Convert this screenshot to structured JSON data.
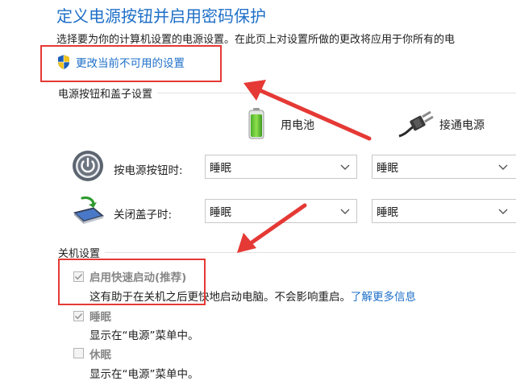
{
  "header": {
    "title": "定义电源按钮并启用密码保护",
    "description": "选择要为你的计算机设置的电源设置。在此页上对设置所做的更改将应用于你所有的电",
    "change_link": "更改当前不可用的设置"
  },
  "power_section": {
    "heading": "电源按钮和盖子设置",
    "battery_label": "用电池",
    "plugged_label": "接通电源",
    "rows": [
      {
        "label": "按电源按钮时:",
        "battery_value": "睡眠",
        "plugged_value": "睡眠"
      },
      {
        "label": "关闭盖子时:",
        "battery_value": "睡眠",
        "plugged_value": "睡眠"
      }
    ]
  },
  "shutdown_section": {
    "heading": "关机设置",
    "options": [
      {
        "title": "启用快速启动(推荐)",
        "sub": "这有助于在关机之后更快地启动电脑。不会影响重启。",
        "link": "了解更多信息",
        "checked": true
      },
      {
        "title": "睡眠",
        "sub": "显示在“电源”菜单中。",
        "checked": true
      },
      {
        "title": "休眠",
        "sub": "显示在“电源”菜单中。",
        "checked": false
      }
    ]
  },
  "colors": {
    "link": "#1e6fc8",
    "highlight": "#e53935",
    "disabled_text": "#888888"
  },
  "icons": [
    "uac-shield-icon",
    "battery-icon",
    "power-plug-icon",
    "power-button-icon",
    "laptop-lid-icon",
    "chevron-down-icon",
    "checkmark-icon",
    "annotation-arrow"
  ]
}
